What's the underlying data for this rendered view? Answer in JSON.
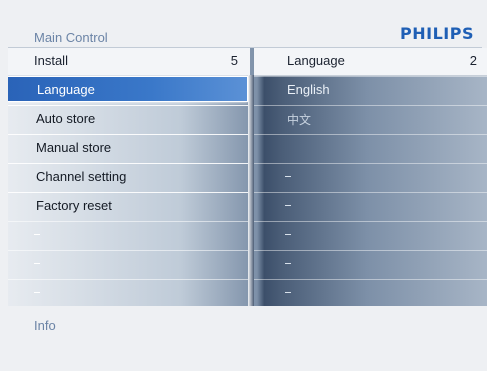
{
  "header": {
    "title": "Main Control",
    "brand": "PHILIPS"
  },
  "left_panel": {
    "heading": "Install",
    "count": "5",
    "items": [
      {
        "label": "Language",
        "selected": true
      },
      {
        "label": "Auto store",
        "selected": false
      },
      {
        "label": "Manual store",
        "selected": false
      },
      {
        "label": "Channel setting",
        "selected": false
      },
      {
        "label": "Factory reset",
        "selected": false
      },
      {
        "label": "",
        "selected": false
      },
      {
        "label": "",
        "selected": false
      },
      {
        "label": "",
        "selected": false
      }
    ]
  },
  "right_panel": {
    "heading": "Language",
    "count": "2",
    "items": [
      {
        "label": "English"
      },
      {
        "label": "中文"
      },
      {
        "label": ""
      },
      {
        "label": ""
      },
      {
        "label": ""
      },
      {
        "label": ""
      },
      {
        "label": ""
      },
      {
        "label": ""
      }
    ]
  },
  "footer": {
    "info": "Info"
  },
  "colors": {
    "brand": "#1f5fb5",
    "selection": "#3a78c9",
    "muted_text": "#6b84a6"
  }
}
